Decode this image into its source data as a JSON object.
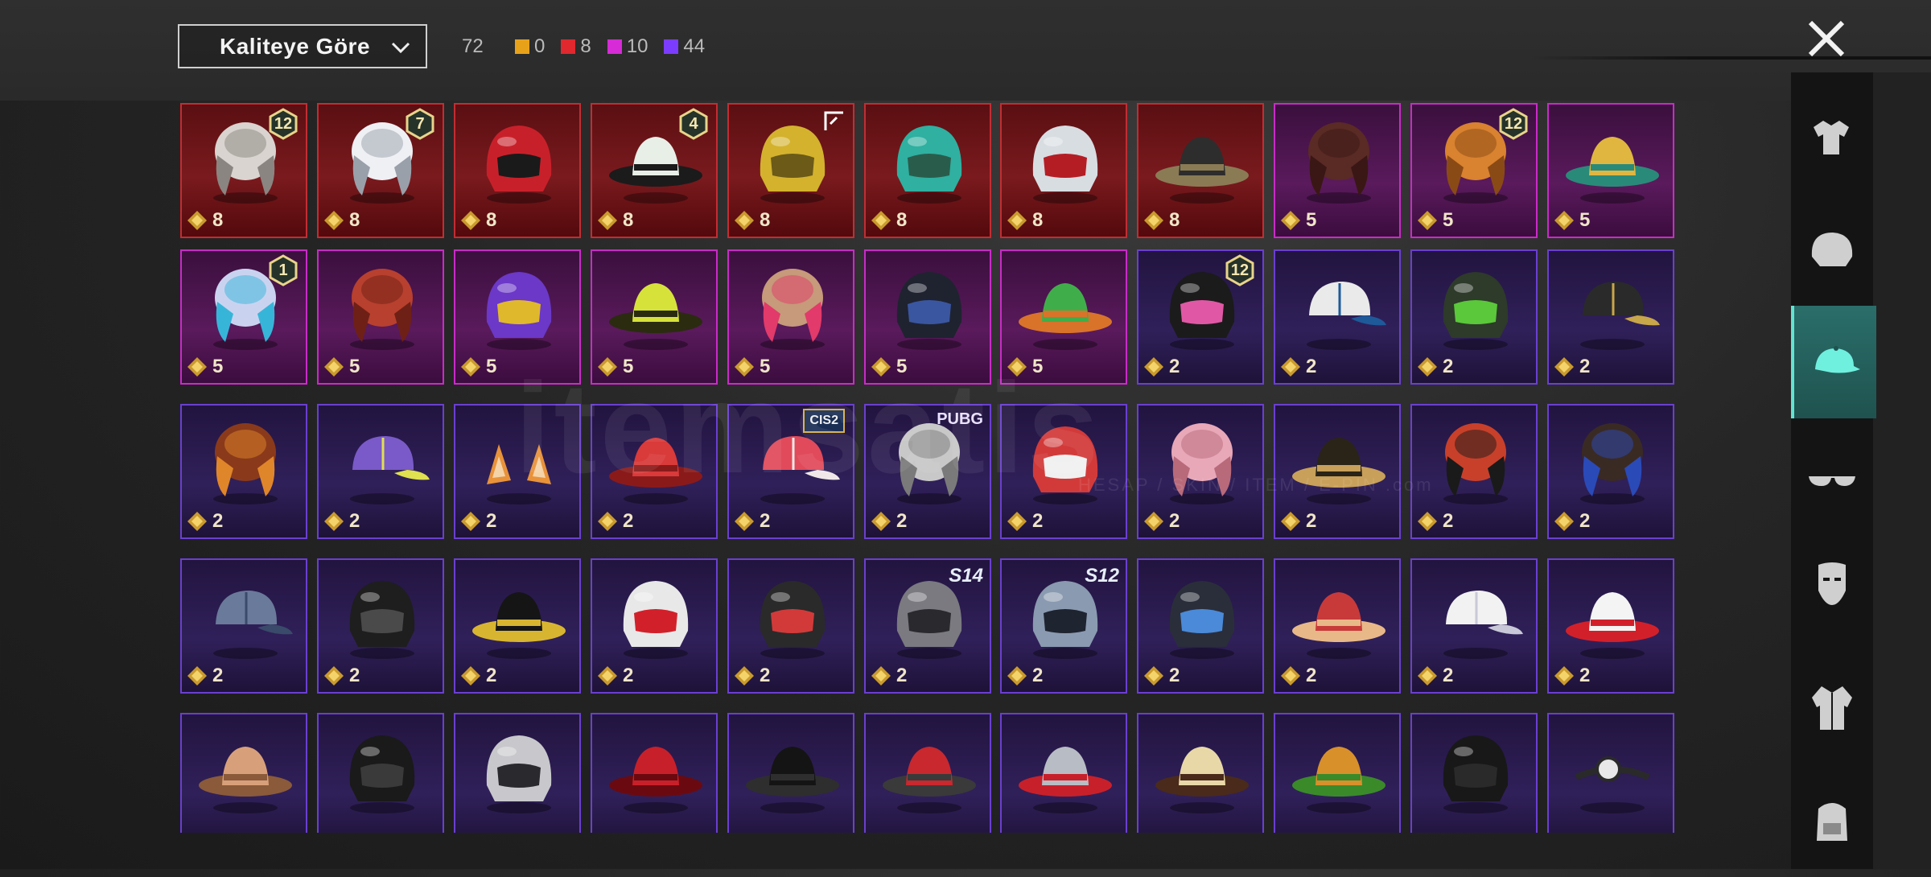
{
  "header": {
    "sort_label": "Kaliteye Göre",
    "total": "72",
    "counts": [
      {
        "value": "0",
        "color": "#e8a21a"
      },
      {
        "value": "8",
        "color": "#e0282e"
      },
      {
        "value": "10",
        "color": "#d62bd6"
      },
      {
        "value": "44",
        "color": "#7b3cff"
      }
    ]
  },
  "watermark": {
    "main": "itemsatis",
    "sub": "HESAP / SKIN / ITEM / E-PIN .com"
  },
  "rows": [
    [
      {
        "cost": "8",
        "q": "red",
        "badge": {
          "type": "level",
          "text": "12"
        },
        "icon": "hair-white-icon"
      },
      {
        "cost": "8",
        "q": "red",
        "badge": {
          "type": "level",
          "text": "7"
        },
        "icon": "hair-silver-icon"
      },
      {
        "cost": "8",
        "q": "red",
        "icon": "red-helmet-icon"
      },
      {
        "cost": "8",
        "q": "red",
        "badge": {
          "type": "level",
          "text": "4"
        },
        "icon": "snowman-hat-icon"
      },
      {
        "cost": "8",
        "q": "red",
        "badge": {
          "type": "corner"
        },
        "icon": "gold-helmet-icon"
      },
      {
        "cost": "8",
        "q": "red",
        "icon": "dragon-helmet-icon"
      },
      {
        "cost": "8",
        "q": "red",
        "icon": "demon-mask-icon"
      },
      {
        "cost": "8",
        "q": "red",
        "icon": "pirate-hat-icon"
      },
      {
        "cost": "5",
        "q": "pink",
        "icon": "brown-hair-icon"
      },
      {
        "cost": "5",
        "q": "pink",
        "badge": {
          "type": "level",
          "text": "12"
        },
        "icon": "orange-hair-icon"
      },
      {
        "cost": "5",
        "q": "pink",
        "icon": "feather-headdress-icon"
      }
    ],
    [
      {
        "cost": "5",
        "q": "pink",
        "badge": {
          "type": "level",
          "text": "1"
        },
        "icon": "pigtail-hair-icon"
      },
      {
        "cost": "5",
        "q": "pink",
        "icon": "red-hair-icon"
      },
      {
        "cost": "5",
        "q": "pink",
        "icon": "luchador-mask-icon"
      },
      {
        "cost": "5",
        "q": "pink",
        "icon": "yellow-bucket-hat-icon"
      },
      {
        "cost": "5",
        "q": "pink",
        "icon": "bow-hair-icon"
      },
      {
        "cost": "5",
        "q": "pink",
        "icon": "black-helmet-icon"
      },
      {
        "cost": "5",
        "q": "pink",
        "icon": "frog-hat-icon"
      },
      {
        "cost": "2",
        "q": "purple",
        "badge": {
          "type": "level",
          "text": "12"
        },
        "icon": "bunny-helmet-icon"
      },
      {
        "cost": "2",
        "q": "purple",
        "icon": "blue-cap-icon"
      },
      {
        "cost": "2",
        "q": "purple",
        "icon": "gas-mask-helmet-icon"
      },
      {
        "cost": "2",
        "q": "purple",
        "icon": "gold-visor-helmet-icon"
      }
    ],
    [
      {
        "cost": "2",
        "q": "purple",
        "icon": "goggle-hair-icon"
      },
      {
        "cost": "2",
        "q": "purple",
        "icon": "rainbow-cap-icon"
      },
      {
        "cost": "2",
        "q": "purple",
        "icon": "cat-ears-icon"
      },
      {
        "cost": "2",
        "q": "purple",
        "icon": "fez-hat-icon"
      },
      {
        "cost": "2",
        "q": "purple",
        "badge": {
          "type": "season",
          "text": "CIS2"
        },
        "icon": "striped-cap-icon"
      },
      {
        "cost": "2",
        "q": "purple",
        "badge": {
          "type": "pubg",
          "text": "PUBG"
        },
        "icon": "gray-hair-icon"
      },
      {
        "cost": "2",
        "q": "purple",
        "icon": "moto-helmet-icon"
      },
      {
        "cost": "2",
        "q": "purple",
        "icon": "pink-braids-icon"
      },
      {
        "cost": "2",
        "q": "purple",
        "icon": "decorated-hat-icon"
      },
      {
        "cost": "2",
        "q": "purple",
        "icon": "red-long-hair-icon"
      },
      {
        "cost": "2",
        "q": "purple",
        "icon": "dark-hair-icon"
      }
    ],
    [
      {
        "cost": "2",
        "q": "purple",
        "icon": "gray-cap-icon"
      },
      {
        "cost": "2",
        "q": "purple",
        "icon": "black-gas-mask-icon"
      },
      {
        "cost": "2",
        "q": "purple",
        "icon": "gold-band-hat-icon"
      },
      {
        "cost": "2",
        "q": "purple",
        "icon": "red-white-beanie-icon"
      },
      {
        "cost": "2",
        "q": "purple",
        "icon": "red-goggle-helmet-icon"
      },
      {
        "cost": "2",
        "q": "purple",
        "badge": {
          "type": "s",
          "text": "S14"
        },
        "icon": "knight-helmet-icon"
      },
      {
        "cost": "2",
        "q": "purple",
        "badge": {
          "type": "s",
          "text": "S12"
        },
        "icon": "steel-helmet-icon"
      },
      {
        "cost": "2",
        "q": "purple",
        "icon": "dark-beanie-icon"
      },
      {
        "cost": "2",
        "q": "purple",
        "icon": "bread-hat-icon"
      },
      {
        "cost": "2",
        "q": "purple",
        "icon": "white-visor-icon"
      },
      {
        "cost": "2",
        "q": "purple",
        "icon": "white-fedora-icon"
      }
    ],
    [
      {
        "q": "purple",
        "icon": "conical-hat-icon"
      },
      {
        "q": "purple",
        "icon": "balaclava-icon"
      },
      {
        "q": "purple",
        "icon": "silver-mask-icon"
      },
      {
        "q": "purple",
        "icon": "red-beret-icon"
      },
      {
        "q": "purple",
        "icon": "black-bowler-icon"
      },
      {
        "q": "purple",
        "icon": "red-fedora-icon"
      },
      {
        "q": "purple",
        "icon": "shark-hat-icon"
      },
      {
        "q": "purple",
        "icon": "cake-hat-icon"
      },
      {
        "q": "purple",
        "icon": "burger-hat-icon"
      },
      {
        "q": "purple",
        "icon": "black-beanie-icon"
      },
      {
        "q": "purple",
        "icon": "headlamp-icon"
      }
    ]
  ],
  "sidebar": [
    {
      "icon": "outfit-icon",
      "active": false
    },
    {
      "icon": "helmet-icon",
      "active": false
    },
    {
      "icon": "cap-icon",
      "active": true
    },
    {
      "icon": "glasses-icon",
      "active": false
    },
    {
      "icon": "mask-icon",
      "active": false
    },
    {
      "icon": "jacket-icon",
      "active": false
    },
    {
      "icon": "backpack-icon",
      "active": false
    }
  ]
}
